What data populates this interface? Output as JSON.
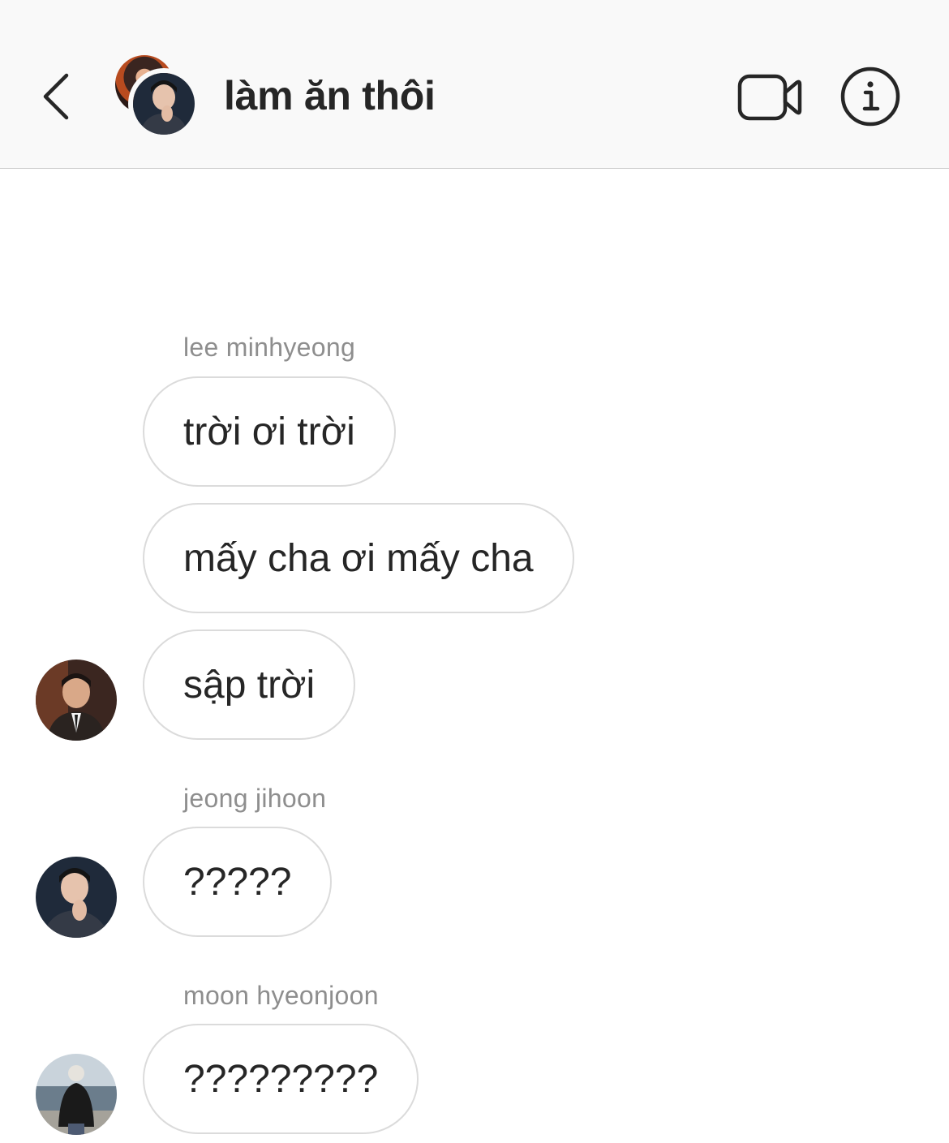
{
  "header": {
    "title": "làm ăn thôi",
    "back_icon": "chevron-left-icon",
    "video_icon": "video-camera-icon",
    "info_icon": "info-icon"
  },
  "messages": [
    {
      "sender": "lee minhyeong",
      "bubbles": [
        "trời ơi trời",
        "mấy cha ơi mấy cha",
        "sập trời"
      ]
    },
    {
      "sender": "jeong jihoon",
      "bubbles": [
        "?????"
      ]
    },
    {
      "sender": "moon hyeonjoon",
      "bubbles": [
        "?????????"
      ]
    }
  ],
  "colors": {
    "header_bg": "#f9f9f9",
    "text": "#262626",
    "sender_text": "#8e8e8e",
    "bubble_border": "#dbdbdb"
  }
}
